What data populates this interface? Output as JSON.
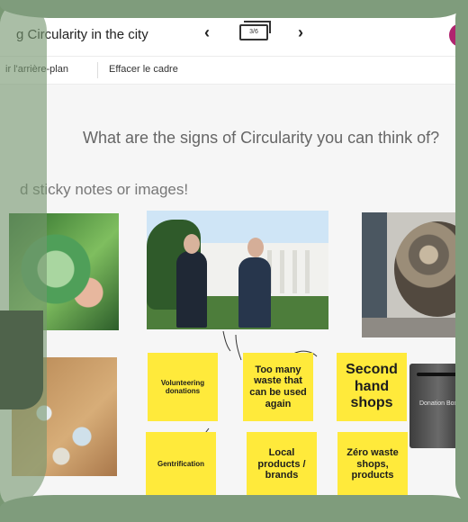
{
  "header": {
    "board_title": "g Circularity in the city",
    "prev_icon": "chevron-left-icon",
    "next_icon": "chevron-right-icon",
    "page_counter": "3/6"
  },
  "toolbar": {
    "background_label": "ir l'arrière-plan",
    "clear_label": "Effacer le cadre"
  },
  "canvas": {
    "question": "What are the signs of Circularity you can think of?",
    "instruction": "d sticky notes or images!"
  },
  "notes": [
    {
      "text": "Volunteering donations"
    },
    {
      "text": "Too many waste that can be used again"
    },
    {
      "text": "Second hand shops"
    },
    {
      "text": "Gentrification"
    },
    {
      "text": "Local products / brands"
    },
    {
      "text": "Zéro waste shops, products"
    }
  ],
  "donation_box": {
    "label": "Donation Box"
  },
  "colors": {
    "sticky": "#ffea3b",
    "frame_green": "#7f9c7c"
  }
}
